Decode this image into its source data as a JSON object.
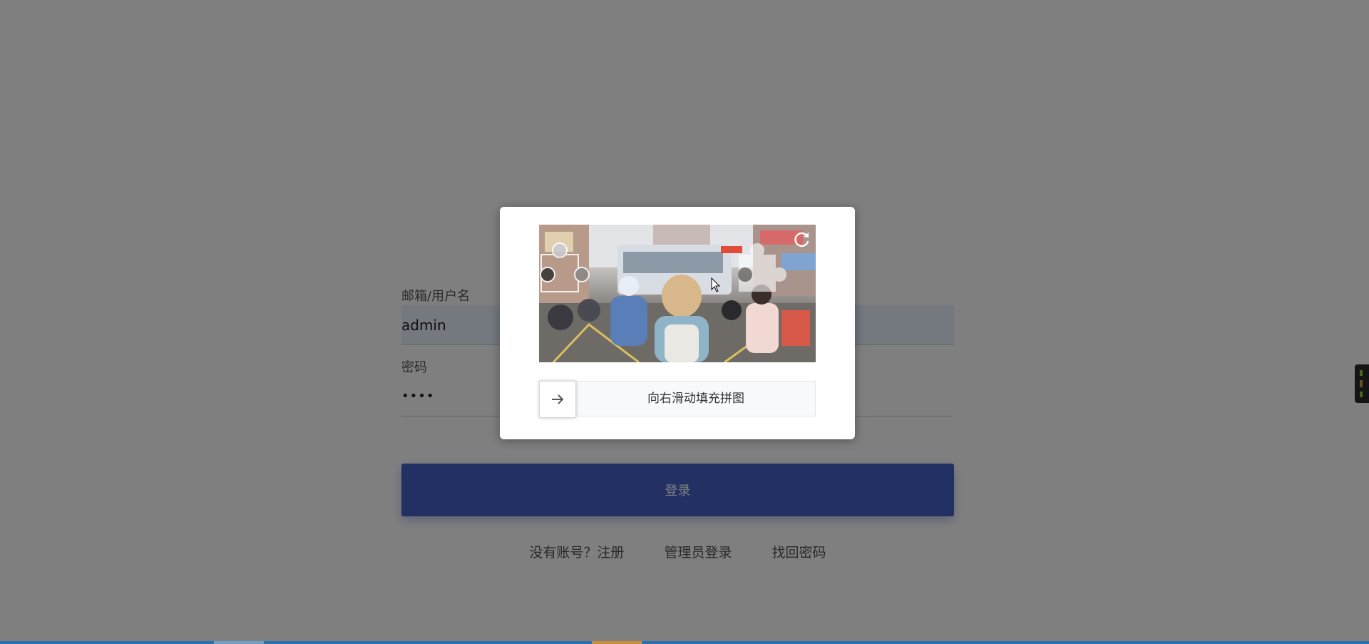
{
  "login": {
    "username_label": "邮箱/用户名",
    "username_value": "admin",
    "password_label": "密码",
    "password_value": "••••",
    "login_button": "登录",
    "register_link": "没有账号？注册",
    "admin_login_link": "管理员登录",
    "recover_link": "找回密码"
  },
  "captcha": {
    "slider_text": "向右滑动填充拼图",
    "handle_icon": "arrow-right-icon",
    "refresh_icon": "refresh-icon",
    "puzzle_progress": 0
  },
  "colors": {
    "primary": "#4460c8",
    "overlay": "rgba(0,0,0,0.5)",
    "autofill_bg": "#e8f0fe"
  }
}
